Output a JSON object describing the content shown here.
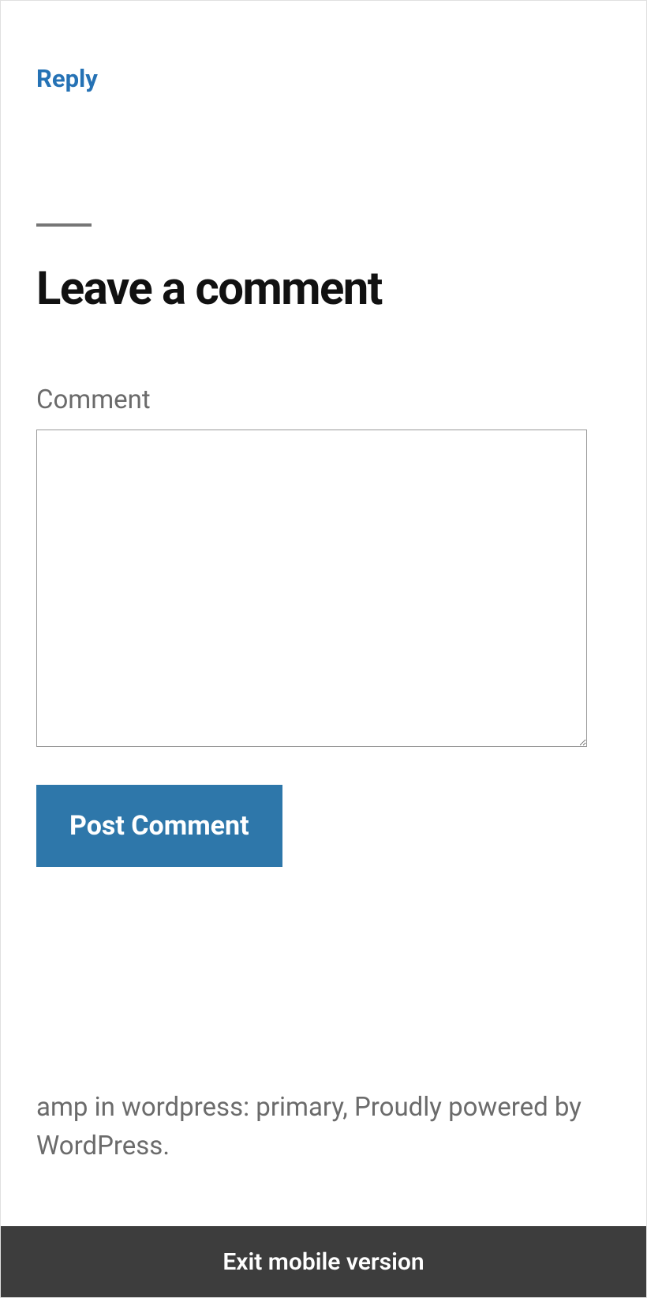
{
  "reply": {
    "label": "Reply"
  },
  "form": {
    "heading": "Leave a comment",
    "comment_label": "Comment",
    "submit_label": "Post Comment"
  },
  "footer": {
    "text": "amp in wordpress: primary, Proudly powered by WordPress."
  },
  "exit": {
    "label": "Exit mobile version"
  }
}
